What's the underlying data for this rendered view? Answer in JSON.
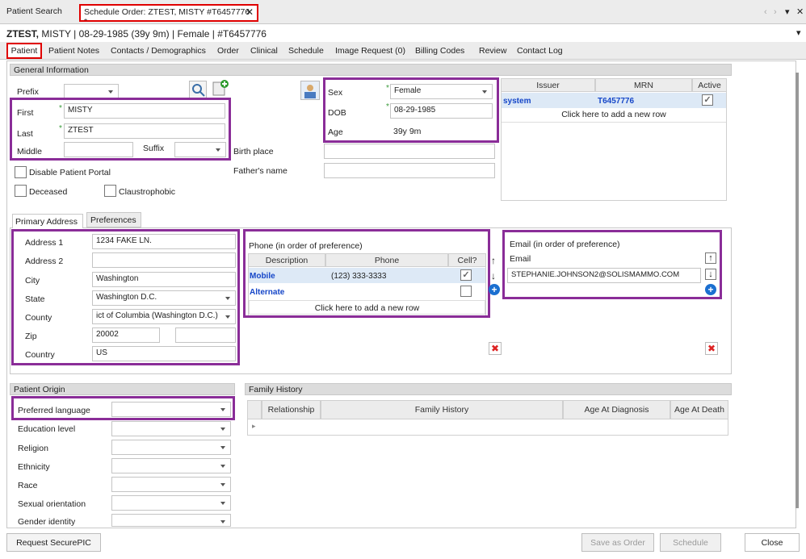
{
  "top_tabs": {
    "search": "Patient Search",
    "order": "Schedule Order: ZTEST, MISTY #T6457776 *"
  },
  "nav": {
    "back": "‹",
    "forward": "›",
    "menu": "▾",
    "close": "✕"
  },
  "header": {
    "name": "ZTEST,",
    "first": "MISTY",
    "rest": "| 08-29-1985 (39y 9m) | Female | #T6457776",
    "dropdown": "▾"
  },
  "tabs": [
    "Patient",
    "Patient Notes",
    "Contacts / Demographics",
    "Order",
    "Clinical",
    "Schedule",
    "Image Request (0)",
    "Billing Codes",
    "Review",
    "Contact Log"
  ],
  "general": {
    "title": "General Information",
    "prefix": "Prefix",
    "first": "First",
    "first_val": "MISTY",
    "last": "Last",
    "last_val": "ZTEST",
    "middle": "Middle",
    "suffix": "Suffix",
    "birth_place": "Birth place",
    "fathers_name": "Father's name",
    "disable_portal": "Disable Patient Portal",
    "deceased": "Deceased",
    "claustrophobic": "Claustrophobic",
    "sex": "Sex",
    "sex_val": "Female",
    "dob": "DOB",
    "dob_val": "08-29-1985",
    "age": "Age",
    "age_val": "39y 9m",
    "req": "*"
  },
  "mrn": {
    "headers": [
      "Issuer",
      "MRN",
      "Active"
    ],
    "issuer": "system",
    "mrn": "T6457776",
    "active": "✓",
    "add": "Click here to add a new row"
  },
  "addr_tabs": [
    "Primary Address",
    "Preferences"
  ],
  "address": {
    "a1": "Address 1",
    "a1_val": "1234 FAKE LN.",
    "a2": "Address 2",
    "city": "City",
    "city_val": "Washington",
    "state": "State",
    "state_val": "Washington D.C.",
    "county": "County",
    "county_val": "ict of Columbia (Washington D.C.)",
    "zip": "Zip",
    "zip_val": "20002",
    "country": "Country",
    "country_val": "US"
  },
  "phone": {
    "title": "Phone (in order of preference)",
    "headers": [
      "Description",
      "Phone",
      "Cell?"
    ],
    "r1_desc": "Mobile",
    "r1_phone": "(123) 333-3333",
    "r1_cell": "✓",
    "r2_desc": "Alternate",
    "add": "Click here to add a new row"
  },
  "email": {
    "title": "Email (in order of preference)",
    "header": "Email",
    "val": "STEPHANIE.JOHNSON2@SOLISMAMMO.COM"
  },
  "arrows": {
    "up": "↑",
    "down": "↓",
    "plus": "+",
    "del": "✖"
  },
  "origin": {
    "title": "Patient Origin",
    "labels": [
      "Preferred language",
      "Education level",
      "Religion",
      "Ethnicity",
      "Race",
      "Sexual orientation",
      "Gender identity"
    ]
  },
  "family": {
    "title": "Family History",
    "headers": [
      "Relationship",
      "Family History",
      "Age At Diagnosis",
      "Age At Death"
    ],
    "marker": "▸"
  },
  "buttons": {
    "securepic": "Request SecurePIC",
    "save": "Save as Order",
    "schedule": "Schedule",
    "close": "Close"
  }
}
